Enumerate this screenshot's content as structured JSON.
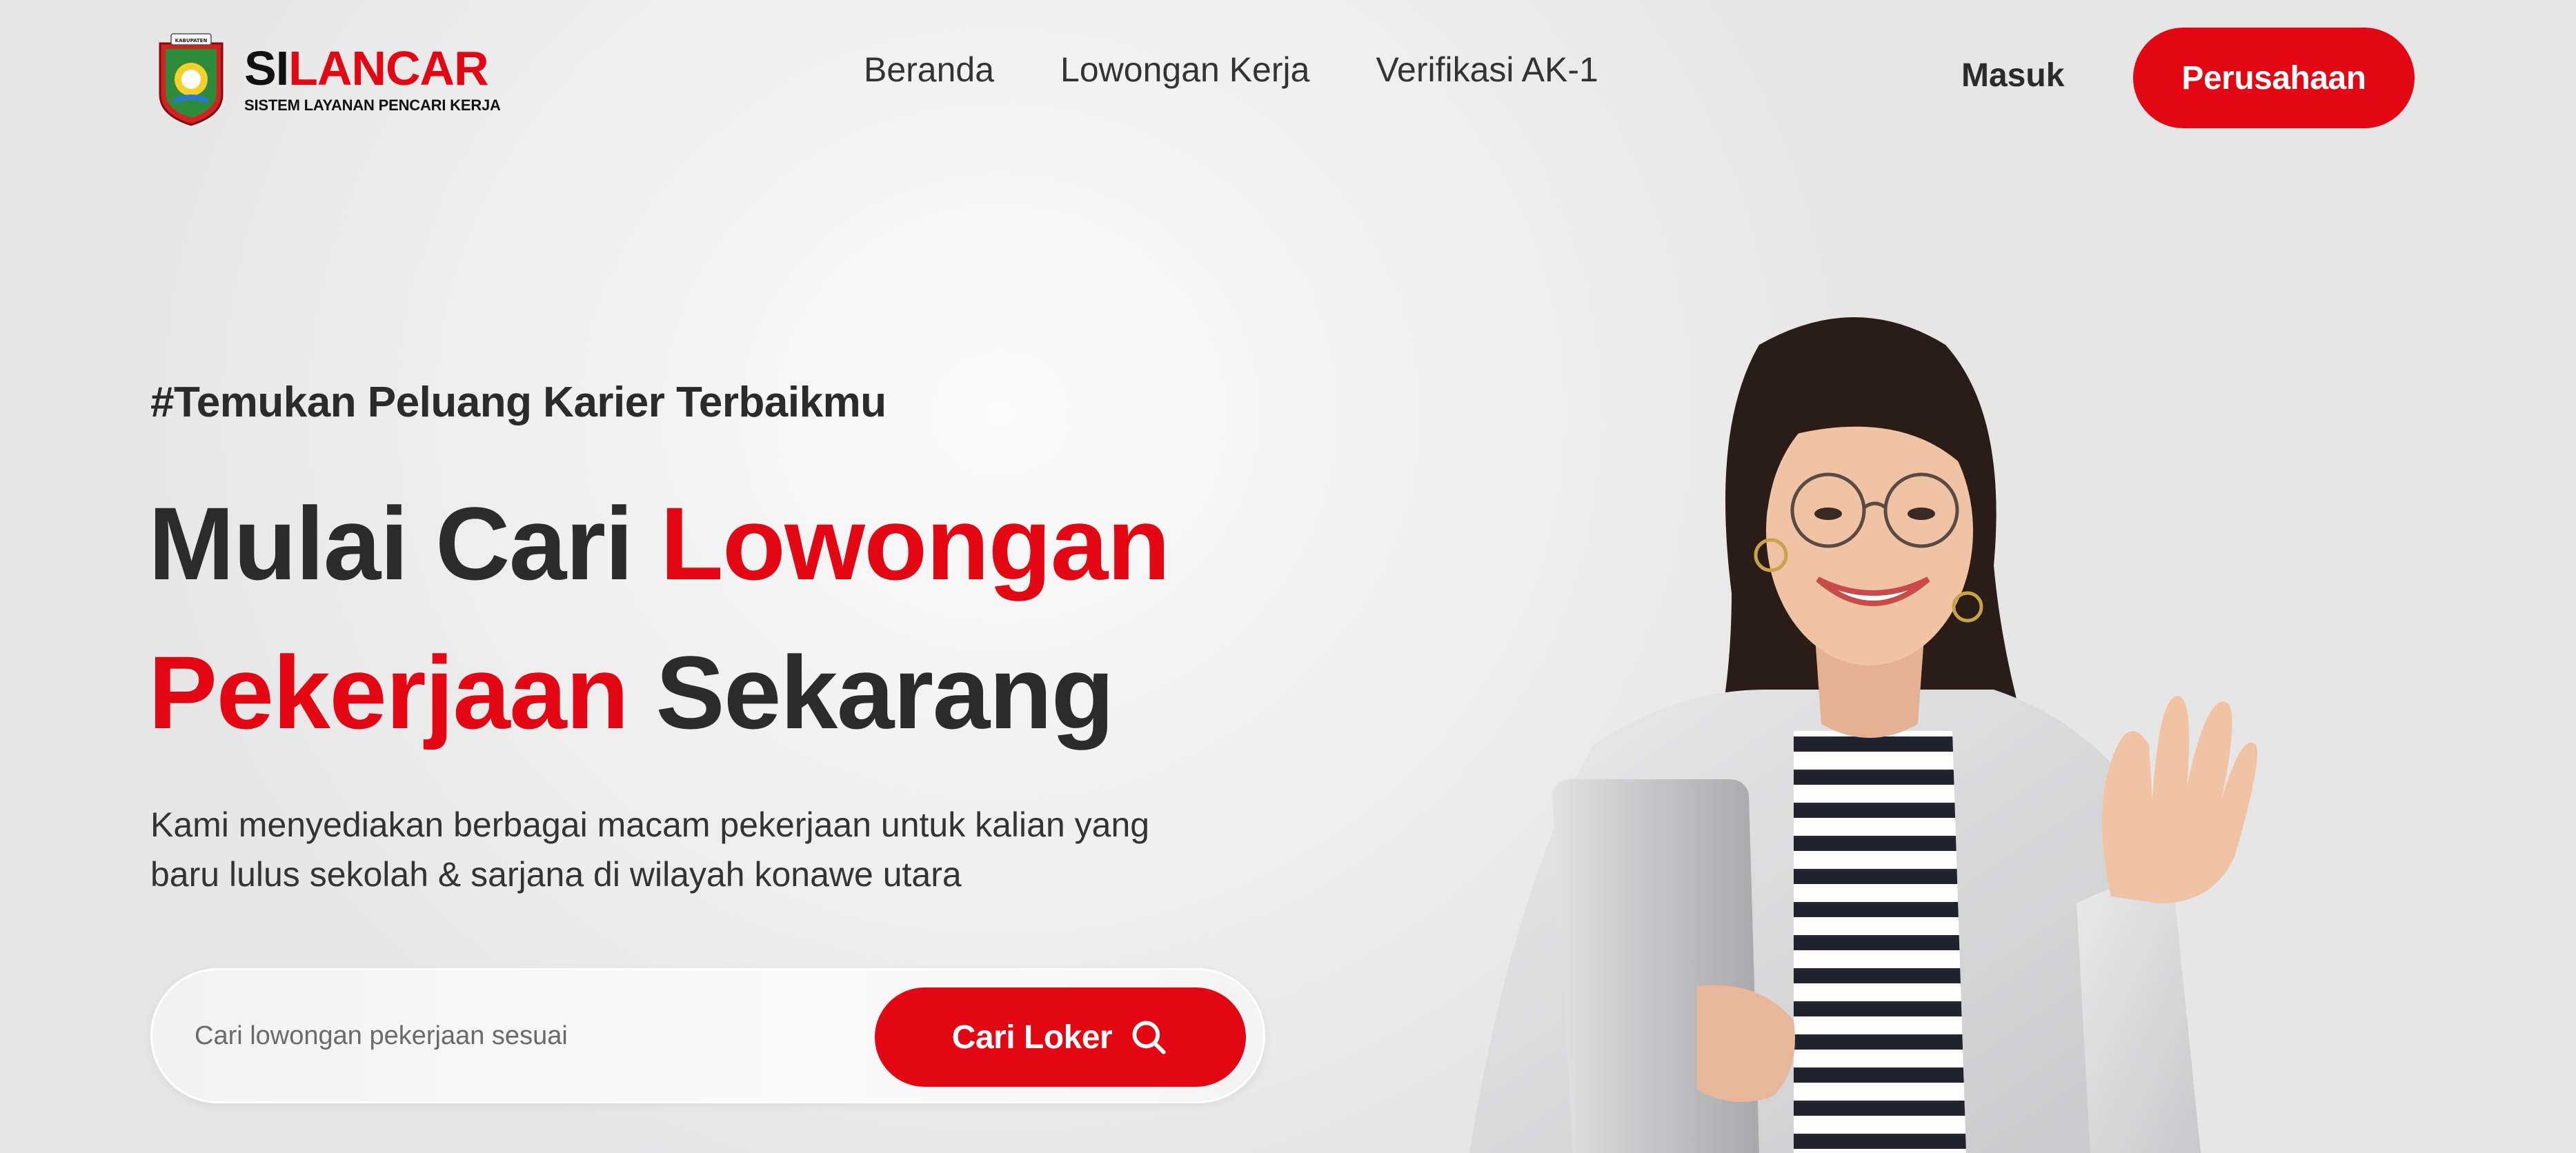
{
  "brand": {
    "title_part1": "SI",
    "title_part2": "LANCAR",
    "subtitle": "SISTEM LAYANAN PENCARI KERJA",
    "emblem_text": "KABUPATEN"
  },
  "nav": {
    "items": [
      {
        "label": "Beranda"
      },
      {
        "label": "Lowongan Kerja"
      },
      {
        "label": "Verifikasi AK-1"
      }
    ],
    "login_label": "Masuk",
    "company_label": "Perusahaan"
  },
  "hero": {
    "tagline": "#Temukan Peluang Karier Terbaikmu",
    "headline": {
      "l1_dark": "Mulai Cari ",
      "l1_red": "Lowongan",
      "l2_red": "Pekerjaan",
      "l2_dark": " Sekarang"
    },
    "description": "Kami menyediakan berbagai macam pekerjaan untuk kalian yang baru lulus sekolah & sarjana di wilayah konawe utara"
  },
  "search": {
    "placeholder": "Cari lowongan pekerjaan sesuai",
    "value": "",
    "button_label": "Cari Loker"
  },
  "icons": {
    "search": "search-icon",
    "emblem": "regency-emblem-icon"
  },
  "colors": {
    "accent": "#e30613",
    "text_dark": "#2b2b2b",
    "background": "#f1f1f1"
  }
}
